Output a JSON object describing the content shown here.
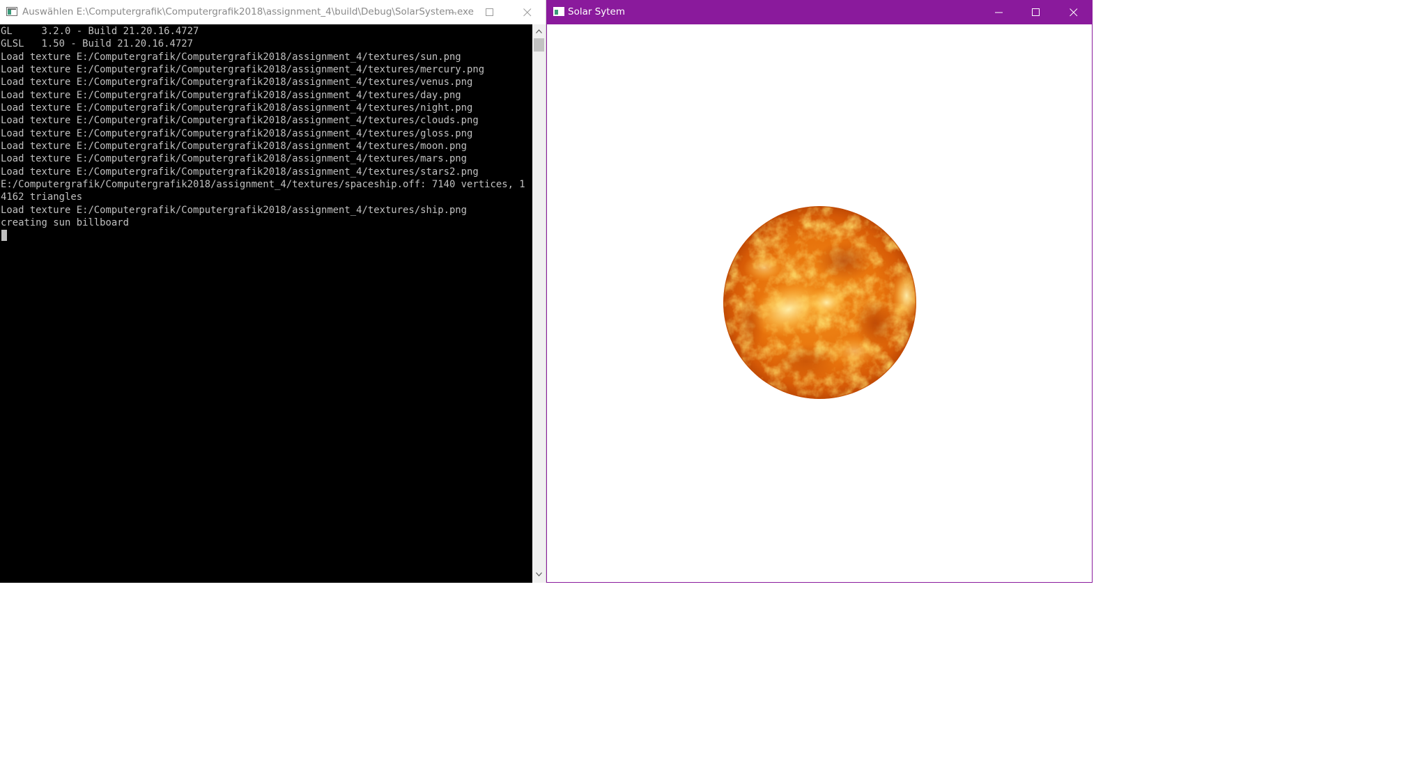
{
  "console_window": {
    "title": "Auswählen E:\\Computergrafik\\Computergrafik2018\\assignment_4\\build\\Debug\\SolarSystem.exe",
    "lines": [
      "GL     3.2.0 - Build 21.20.16.4727",
      "GLSL   1.50 - Build 21.20.16.4727",
      "Load texture E:/Computergrafik/Computergrafik2018/assignment_4/textures/sun.png",
      "Load texture E:/Computergrafik/Computergrafik2018/assignment_4/textures/mercury.png",
      "Load texture E:/Computergrafik/Computergrafik2018/assignment_4/textures/venus.png",
      "Load texture E:/Computergrafik/Computergrafik2018/assignment_4/textures/day.png",
      "Load texture E:/Computergrafik/Computergrafik2018/assignment_4/textures/night.png",
      "Load texture E:/Computergrafik/Computergrafik2018/assignment_4/textures/clouds.png",
      "Load texture E:/Computergrafik/Computergrafik2018/assignment_4/textures/gloss.png",
      "Load texture E:/Computergrafik/Computergrafik2018/assignment_4/textures/moon.png",
      "Load texture E:/Computergrafik/Computergrafik2018/assignment_4/textures/mars.png",
      "Load texture E:/Computergrafik/Computergrafik2018/assignment_4/textures/stars2.png",
      "E:/Computergrafik/Computergrafik2018/assignment_4/textures/spaceship.off: 7140 vertices, 1",
      "4162 triangles",
      "Load texture E:/Computergrafik/Computergrafik2018/assignment_4/textures/ship.png",
      "creating sun billboard"
    ],
    "text_color": "#c0c0c0",
    "background_color": "#000000"
  },
  "solar_window": {
    "title": "Solar Sytem",
    "accent_color": "#8a1a9c",
    "scene": {
      "object": "sun-sphere",
      "background_color": "#ffffff"
    }
  },
  "icons": {
    "app": "console-app-icon",
    "minimize": "minimize-icon",
    "maximize": "maximize-icon",
    "close": "close-icon",
    "scroll_up": "scroll-up-arrow-icon",
    "scroll_down": "scroll-down-arrow-icon"
  }
}
